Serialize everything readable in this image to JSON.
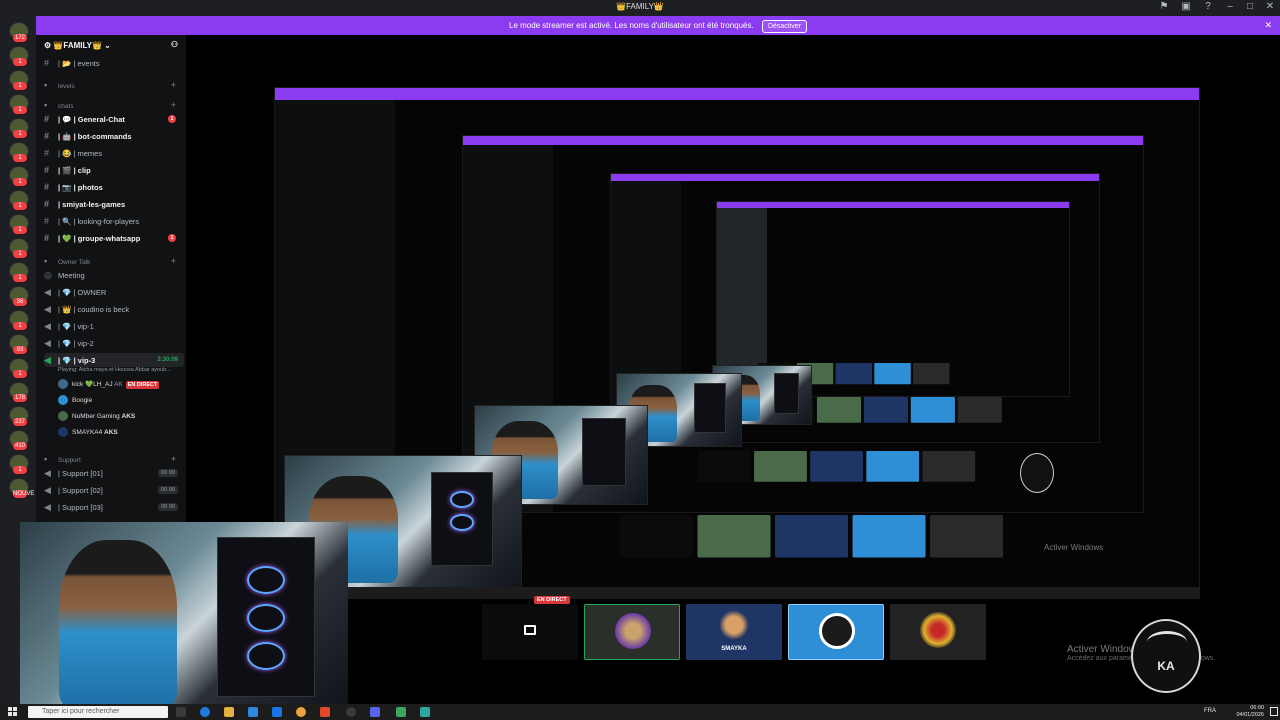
{
  "window": {
    "title": "👑FAMILY👑"
  },
  "banner": {
    "text": "Le mode streamer est activé. Les noms d'utilisateur ont été tronqués.",
    "button": "Désactiver"
  },
  "guild_badges": [
    "172",
    "1",
    "1",
    "1",
    "1",
    "1",
    "1",
    "1",
    "1",
    "1",
    "1",
    "36",
    "1",
    "93",
    "1",
    "178",
    "237",
    "410",
    "1",
    "NOUVE"
  ],
  "server": {
    "name": "👑FAMILY👑"
  },
  "channels": [
    {
      "name": "| 📂 | events",
      "kind": "text"
    },
    {
      "name": "levels",
      "kind": "category"
    },
    {
      "name": "chats",
      "kind": "category"
    },
    {
      "name": "| 💬 | General-Chat",
      "kind": "text",
      "unread": true,
      "mentions": "1"
    },
    {
      "name": "| 🤖 | bot-commands",
      "kind": "text",
      "unread": true
    },
    {
      "name": "| 😂 | memes",
      "kind": "text"
    },
    {
      "name": "| 🎬 | clip",
      "kind": "text",
      "unread": true
    },
    {
      "name": "| 📷 | photos",
      "kind": "text",
      "unread": true
    },
    {
      "name": "| smiyat-les-games",
      "kind": "text",
      "unread": true
    },
    {
      "name": "| 🔍 | looking-for-players",
      "kind": "text"
    },
    {
      "name": "| 💚 | groupe-whatsapp",
      "kind": "text",
      "unread": true,
      "mentions": "1"
    },
    {
      "name": "Owner Talk",
      "kind": "category"
    },
    {
      "name": "Meeting",
      "kind": "voice-header"
    },
    {
      "name": "| 💎 | OWNER",
      "kind": "voice"
    },
    {
      "name": "| 👑 | coudino is beck",
      "kind": "voice"
    },
    {
      "name": "| 💎 | vip-1",
      "kind": "voice"
    },
    {
      "name": "| 💎 | vip-2",
      "kind": "voice"
    },
    {
      "name": "| 💎 | vip-3",
      "kind": "voice",
      "active": true,
      "timer": "3:30:09"
    }
  ],
  "voice_activity": "Playing: Aicha maya et Houssa Abbar ayoub...",
  "voice_users": [
    {
      "name": "kick 💚LH_AJ",
      "tag": "AK",
      "live": "EN DIRECT"
    },
    {
      "name": "Boogie",
      "tag": ""
    },
    {
      "name": "NuMber Gaming",
      "tag": "AKS"
    },
    {
      "name": "SMAYKA4",
      "tag": "AKS"
    }
  ],
  "support_category": "Support",
  "support_channels": [
    {
      "name": "| Support [01]",
      "count": "00",
      "limit": "99"
    },
    {
      "name": "| Support [02]",
      "count": "00",
      "limit": "99"
    },
    {
      "name": "| Support [03]",
      "count": "00",
      "limit": "99"
    }
  ],
  "stream": {
    "live_label": "EN DIRECT",
    "tiles": [
      {
        "name": "screen-share",
        "label": ""
      },
      {
        "name": "avatar-number-gaming",
        "label": "",
        "color": "#4a6b4a"
      },
      {
        "name": "avatar-smayka",
        "label": "SMAYKA",
        "color": "#1f3566"
      },
      {
        "name": "avatar-boogie",
        "label": "",
        "color": "#2e8fd6"
      },
      {
        "name": "avatar-gamer",
        "label": "",
        "color": "#2a2a2a"
      }
    ]
  },
  "activate_windows": {
    "title": "Activer Windows",
    "subtitle": "Accédez aux paramètres pour activer Windows."
  },
  "logo_text": "KA",
  "taskbar": {
    "search_placeholder": "Taper ici pour rechercher",
    "language": "FRA",
    "time": "06:00",
    "date": "04/01/2026"
  },
  "colors": {
    "accent": "#8c3cf0",
    "live": "#da373c",
    "mention": "#f23f43",
    "voice_active": "#23a55a"
  }
}
